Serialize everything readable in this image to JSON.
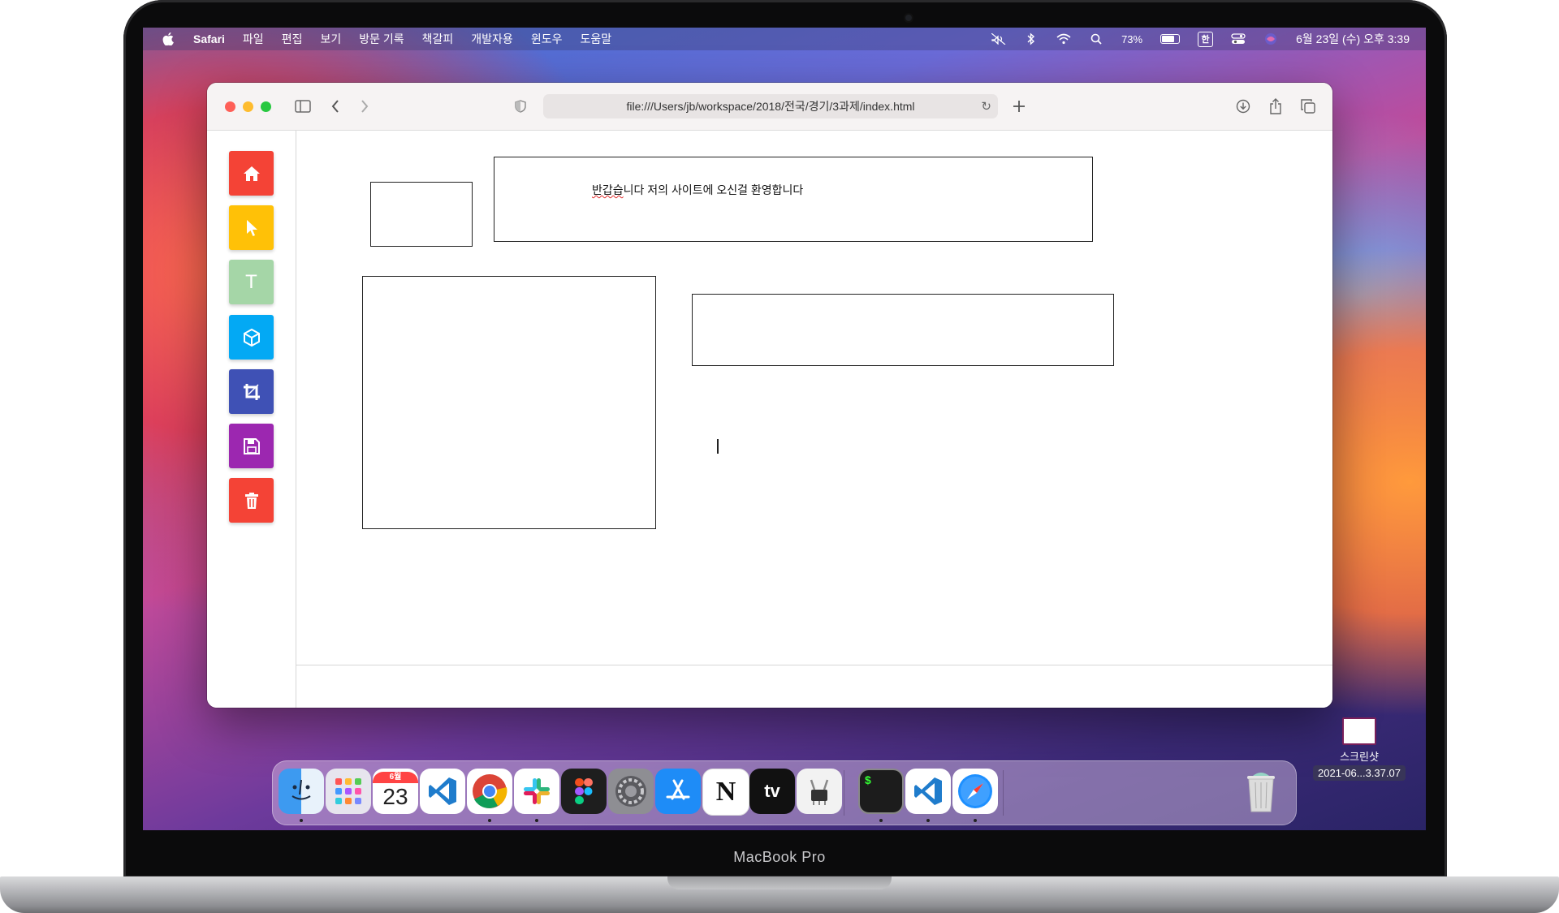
{
  "device": {
    "model_label": "MacBook Pro"
  },
  "menubar": {
    "app_name": "Safari",
    "menus": [
      "파일",
      "편집",
      "보기",
      "방문 기록",
      "책갈피",
      "개발자용",
      "윈도우",
      "도움말"
    ],
    "battery_percent": "73%",
    "input_source": "한",
    "datetime": "6월 23일 (수) 오후 3:39"
  },
  "safari": {
    "url": "file:///Users/jb/workspace/2018/전국/경기/3과제/index.html"
  },
  "page": {
    "greeting_squiggle": "반갑습",
    "greeting_rest": "니다 저의 사이트에 오신걸 환영합니다"
  },
  "tools": [
    {
      "name": "home-tool",
      "icon": "home-icon",
      "color": "#f44336"
    },
    {
      "name": "select-tool",
      "icon": "cursor-icon",
      "color": "#ffc107"
    },
    {
      "name": "text-tool",
      "icon": "text-icon",
      "label": "T",
      "color": "#a5d6a7"
    },
    {
      "name": "box-tool",
      "icon": "cube-icon",
      "color": "#03a9f4"
    },
    {
      "name": "crop-tool",
      "icon": "crop-icon",
      "color": "#3f51b5"
    },
    {
      "name": "save-tool",
      "icon": "floppy-icon",
      "color": "#9c27b0"
    },
    {
      "name": "delete-tool",
      "icon": "trash-icon",
      "color": "#f44336"
    }
  ],
  "dock": {
    "calendar_month": "6월",
    "calendar_day": "23",
    "apps": [
      "Finder",
      "Launchpad",
      "Calendar",
      "Visual Studio Code",
      "Google Chrome",
      "Slack",
      "Figma",
      "System Preferences",
      "App Store",
      "Notion",
      "Apple TV",
      "System Information",
      "Terminal",
      "Visual Studio Code",
      "Safari",
      "Trash"
    ],
    "appletv_label": "tv",
    "notion_label": "N",
    "terminal_label": "$"
  },
  "desktop_file": {
    "name": "스크린샷",
    "date": "2021-06...3.37.07"
  }
}
